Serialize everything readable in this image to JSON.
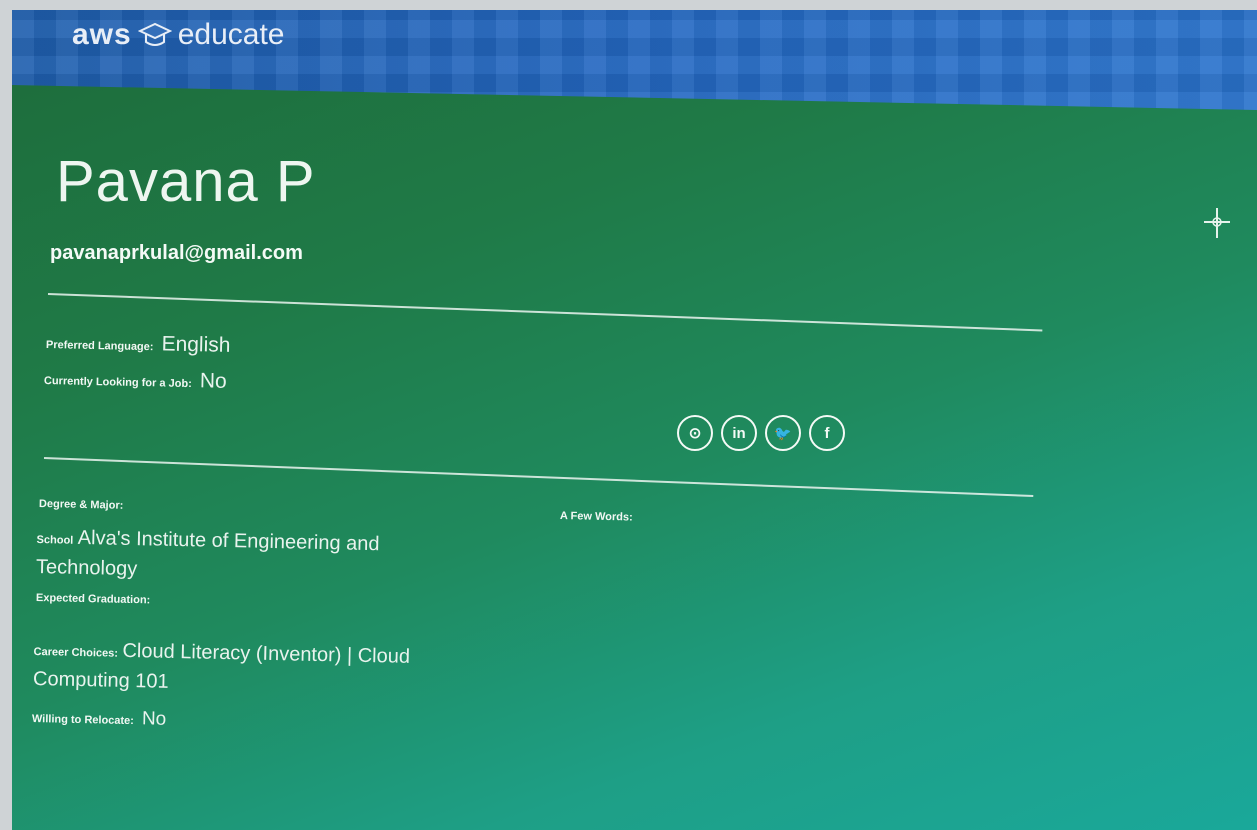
{
  "header": {
    "logo_aws": "aws",
    "logo_educate": "educate",
    "logo_icon": "graduation-cap-icon"
  },
  "profile": {
    "name": "Pavana P",
    "email": "pavanaprkulal@gmail.com"
  },
  "preferences": {
    "language_label": "Preferred Language:",
    "language_value": "English",
    "job_label": "Currently Looking for a Job:",
    "job_value": "No"
  },
  "social": [
    {
      "icon": "github-icon",
      "glyph": "⊙"
    },
    {
      "icon": "linkedin-icon",
      "glyph": "in"
    },
    {
      "icon": "twitter-icon",
      "glyph": "🐦"
    },
    {
      "icon": "facebook-icon",
      "glyph": "f"
    }
  ],
  "education": {
    "degree_label": "Degree & Major:",
    "school_label": "School",
    "school_value_line1": "Alva's Institute of Engineering and",
    "school_value_line2": "Technology",
    "graduation_label": "Expected Graduation:",
    "career_label": "Career Choices:",
    "career_value_line1": "Cloud Literacy (Inventor) | Cloud",
    "career_value_line2": "Computing 101",
    "relocate_label": "Willing to Relocate:",
    "relocate_value": "No"
  },
  "about": {
    "few_words_label": "A Few Words:"
  },
  "colors": {
    "banner_blue": "#2468c2",
    "background_green": "#1f7a47",
    "background_teal": "#1aa89a"
  }
}
